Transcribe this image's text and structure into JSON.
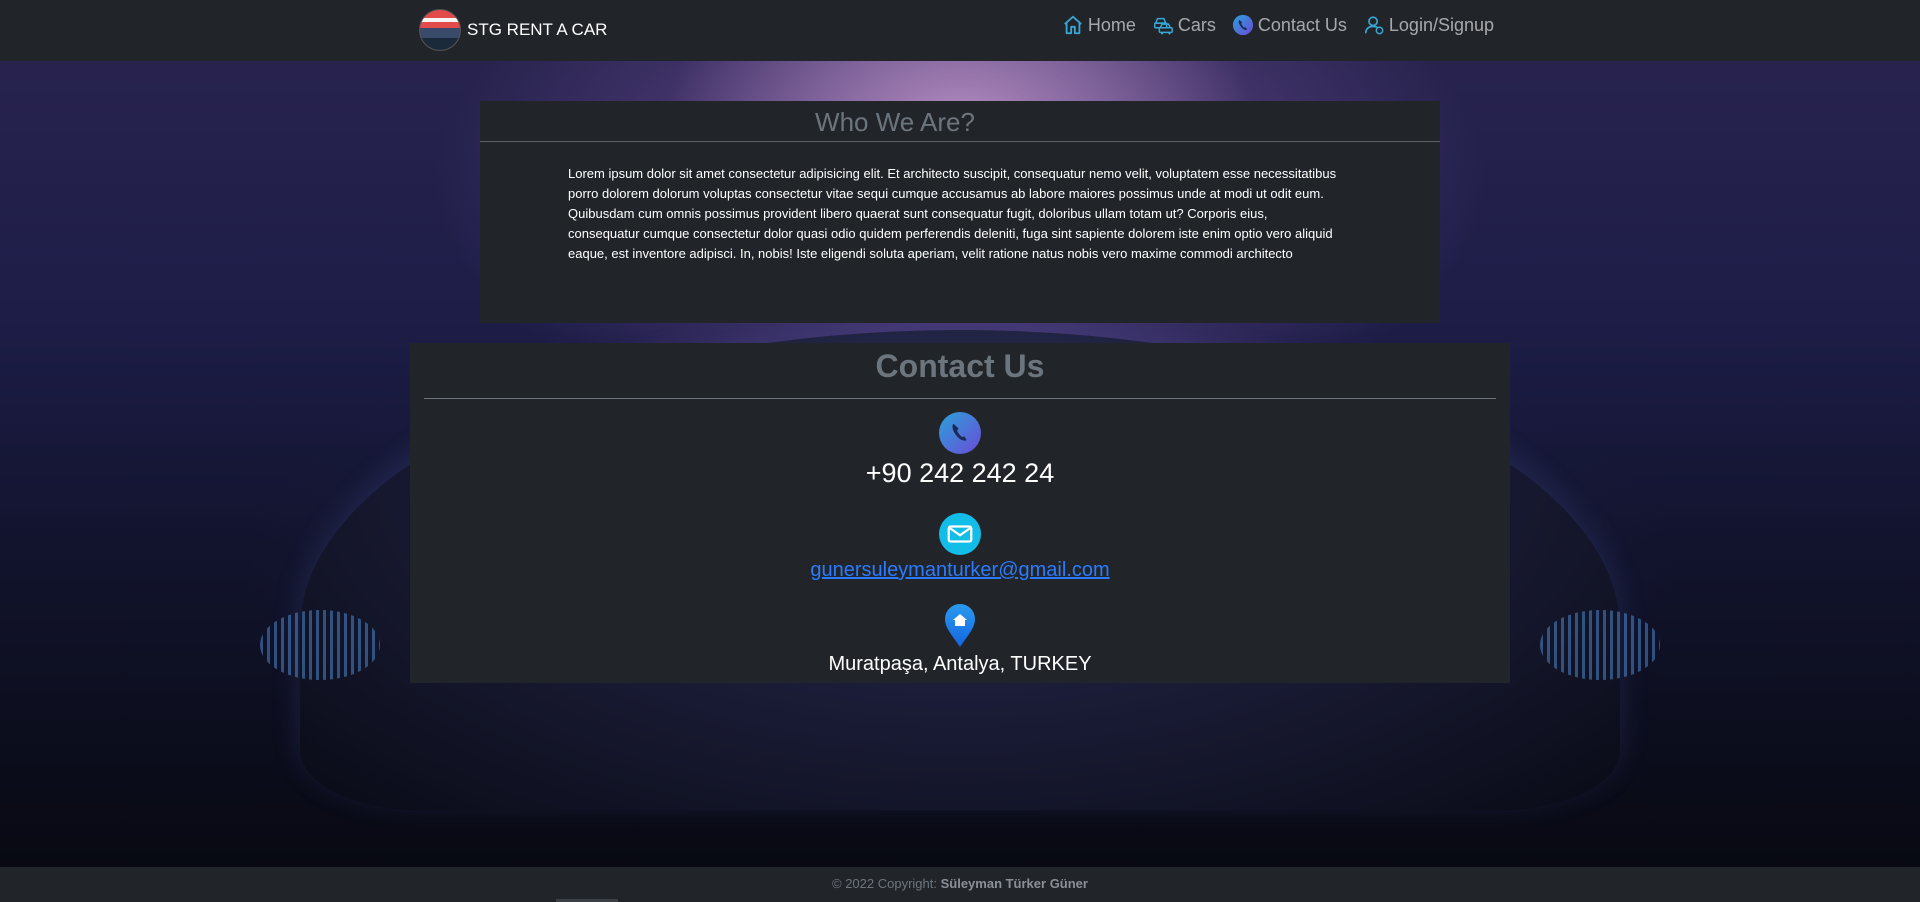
{
  "brand": {
    "name": "STG RENT A CAR"
  },
  "nav": [
    {
      "label": "Home",
      "icon": "home-icon"
    },
    {
      "label": "Cars",
      "icon": "cars-icon"
    },
    {
      "label": "Contact Us",
      "icon": "phone-icon"
    },
    {
      "label": "Login/Signup",
      "icon": "user-icon"
    }
  ],
  "who": {
    "title": "Who We Are?",
    "text": "Lorem ipsum dolor sit amet consectetur adipisicing elit. Et architecto suscipit, consequatur nemo velit, voluptatem esse necessitatibus porro dolorem dolorum voluptas consectetur vitae sequi cumque accusamus ab labore maiores possimus unde at modi ut odit eum. Quibusdam cum omnis possimus provident libero quaerat sunt consequatur fugit, doloribus ullam totam ut? Corporis eius, consequatur cumque consectetur dolor quasi odio quidem perferendis deleniti, fuga sint sapiente dolorem iste enim optio vero aliquid eaque, est inventore adipisci. In, nobis! Iste eligendi soluta aperiam, velit ratione natus nobis vero maxime commodi architecto"
  },
  "contact": {
    "title": "Contact Us",
    "phone": "+90 242 242 24",
    "email": "gunersuleymanturker@gmail.com",
    "address": "Muratpaşa, Antalya, TURKEY"
  },
  "footer": {
    "prefix": "© 2022 Copyright: ",
    "author": "Süleyman Türker Güner"
  }
}
